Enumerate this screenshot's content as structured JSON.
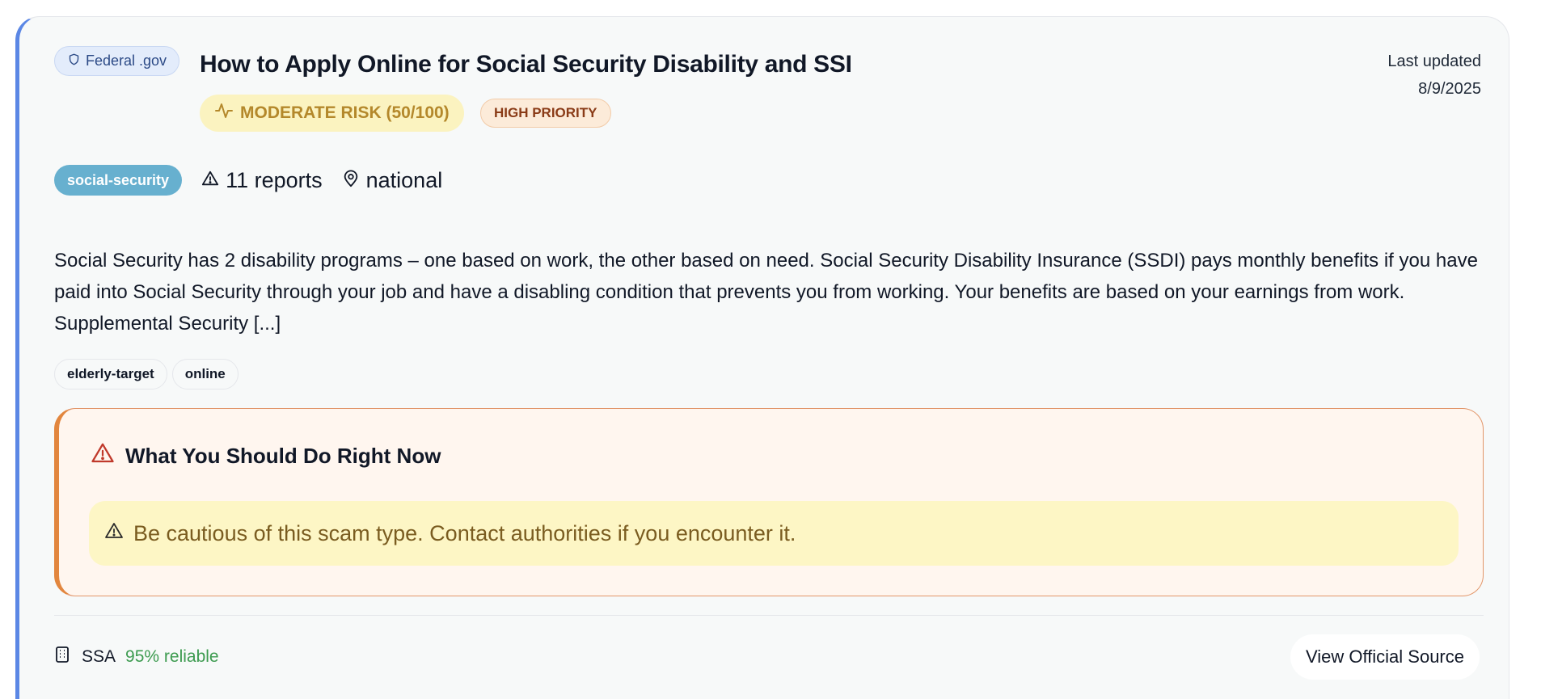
{
  "card": {
    "source_badge": "Federal .gov",
    "title": "How to Apply Online for Social Security Disability and SSI",
    "last_updated_label": "Last updated",
    "last_updated_date": "8/9/2025",
    "risk_badge": "MODERATE RISK (50/100)",
    "priority_badge": "HIGH PRIORITY",
    "category": "social-security",
    "reports": "11 reports",
    "location": "national",
    "description": "Social Security has 2 disability programs – one based on work, the other based on need. Social Security Disability Insurance (SSDI) pays monthly benefits if you have paid into Social Security through your job and have a disabling condition that prevents you from working. Your benefits are based on your earnings from work. Supplemental Security [...]",
    "tags": [
      "elderly-target",
      "online"
    ],
    "action": {
      "heading": "What You Should Do Right Now",
      "advice": "Be cautious of this scam type. Contact authorities if you encounter it."
    },
    "footer": {
      "source_name": "SSA",
      "reliability": "95% reliable",
      "view_button": "View Official Source"
    }
  },
  "colors": {
    "accent_blue": "#5b87e5",
    "risk_yellow": "#fbf3c0",
    "priority_orange": "#fcebd9",
    "category_teal": "#67b0cf",
    "action_orange": "#e2863e",
    "reliable_green": "#3d9b50",
    "alert_red": "#c0392b"
  },
  "icons": {
    "gov": "shield-icon",
    "risk": "activity-icon",
    "reports": "warning-triangle-icon",
    "location": "map-pin-icon",
    "action": "alert-triangle-icon",
    "source": "building-icon"
  }
}
